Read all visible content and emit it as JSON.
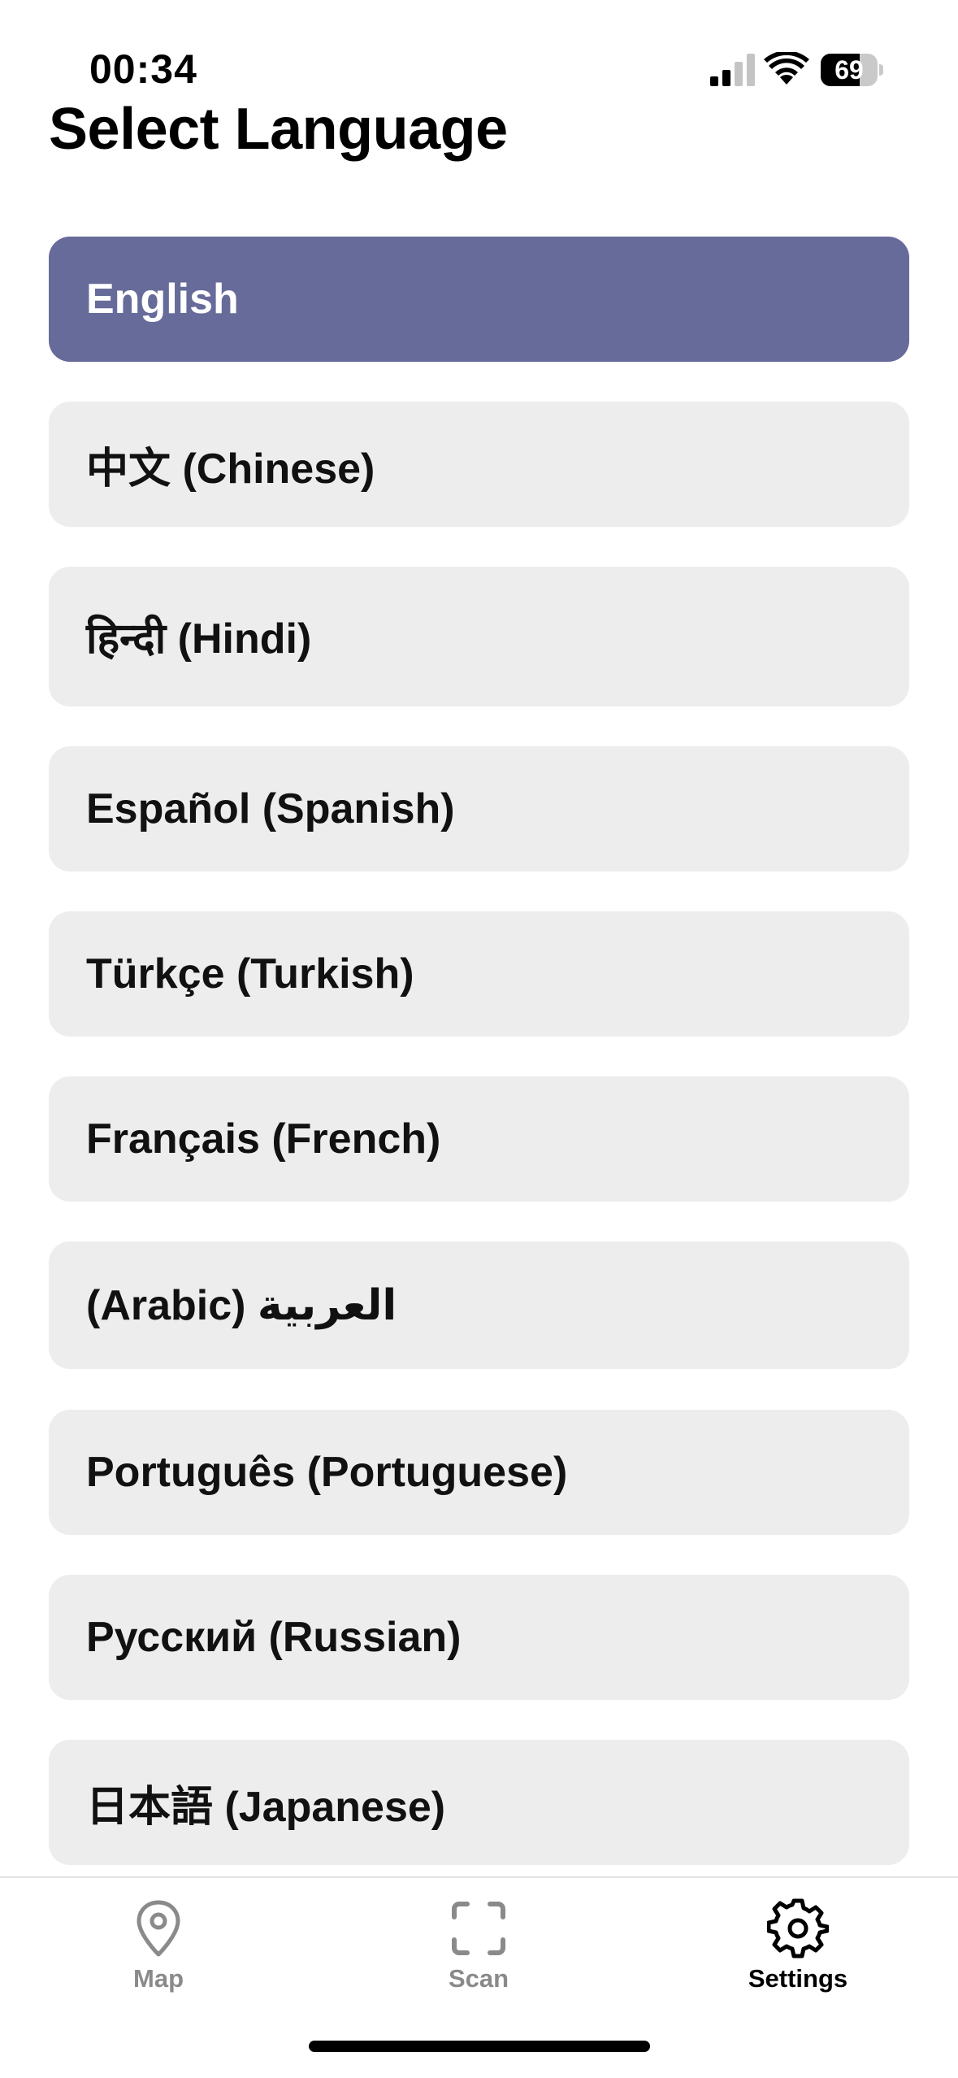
{
  "status_bar": {
    "time": "00:34",
    "battery_level": "69",
    "battery_percent": 69,
    "signal_bars_active": 2,
    "signal_bars_total": 4
  },
  "page": {
    "title": "Select Language"
  },
  "languages": [
    {
      "label": "English",
      "selected": true
    },
    {
      "label": "中文 (Chinese)",
      "selected": false
    },
    {
      "label": "हिन्दी (Hindi)",
      "selected": false
    },
    {
      "label": "Español (Spanish)",
      "selected": false
    },
    {
      "label": "Türkçe (Turkish)",
      "selected": false
    },
    {
      "label": "Français (French)",
      "selected": false
    },
    {
      "label": "(Arabic) العربية",
      "selected": false
    },
    {
      "label": "Português (Portuguese)",
      "selected": false
    },
    {
      "label": "Русский (Russian)",
      "selected": false
    },
    {
      "label": "日本語 (Japanese)",
      "selected": false
    }
  ],
  "tab_bar": {
    "tabs": [
      {
        "label": "Map",
        "icon": "map-pin-icon",
        "active": false
      },
      {
        "label": "Scan",
        "icon": "scan-icon",
        "active": false
      },
      {
        "label": "Settings",
        "icon": "gear-icon",
        "active": true
      }
    ]
  },
  "colors": {
    "selected_background": "#676b9a",
    "item_background": "#ededed",
    "inactive_tab": "#8a8a8a",
    "active_tab": "#000000"
  }
}
